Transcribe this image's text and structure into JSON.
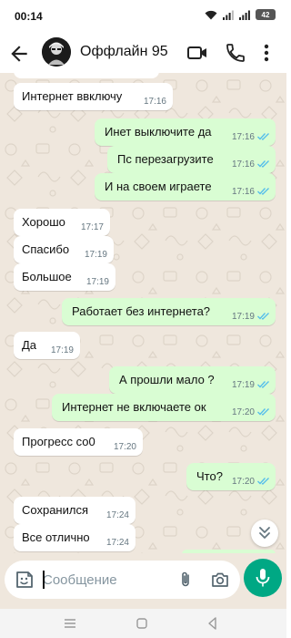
{
  "status_bar": {
    "time": "00:14",
    "battery": "42"
  },
  "header": {
    "contact_name": "Оффлайн 95"
  },
  "messages": [
    {
      "direction": "in",
      "text": "Интернет ввключу",
      "time": "17:16"
    },
    {
      "direction": "out",
      "text": "Инет выключите да",
      "time": "17:16",
      "read": true
    },
    {
      "direction": "out",
      "text": "Пс перезагрузите",
      "time": "17:16",
      "read": true
    },
    {
      "direction": "out",
      "text": "И на своем играете",
      "time": "17:16",
      "read": true
    },
    {
      "direction": "in",
      "text": "Хорошо",
      "time": "17:17"
    },
    {
      "direction": "in",
      "text": "Спасибо",
      "time": "17:19"
    },
    {
      "direction": "in",
      "text": "Большое",
      "time": "17:19"
    },
    {
      "direction": "out",
      "text": "Работает без интернета?",
      "time": "17:19",
      "read": true
    },
    {
      "direction": "in",
      "text": "Да",
      "time": "17:19"
    },
    {
      "direction": "out",
      "text": "А прошли мало ?",
      "time": "17:19",
      "read": true
    },
    {
      "direction": "out",
      "text": "Интернет не включаете ок",
      "time": "17:20",
      "read": true
    },
    {
      "direction": "in",
      "text": "Прогресс со0",
      "time": "17:20"
    },
    {
      "direction": "out",
      "text": "Что?",
      "time": "17:20",
      "read": true
    },
    {
      "direction": "in",
      "text": "Сохранился",
      "time": "17:24"
    },
    {
      "direction": "in",
      "text": "Все отлично",
      "time": "17:24"
    }
  ],
  "input": {
    "placeholder": "Сообщение"
  },
  "colors": {
    "accent": "#00a884",
    "outgoing_bubble": "#d9fdd3",
    "incoming_bubble": "#ffffff",
    "chat_background": "#efe7dd",
    "read_ticks": "#53bdeb"
  },
  "icons": {
    "back": "arrow-left-icon",
    "video_call": "video-camera-icon",
    "voice_call": "phone-icon",
    "menu": "more-vertical-icon",
    "sticker": "sticker-icon",
    "attach": "paperclip-icon",
    "camera": "camera-icon",
    "mic": "microphone-icon",
    "scroll_down": "double-chevron-down-icon",
    "read_receipt": "double-check-icon"
  }
}
